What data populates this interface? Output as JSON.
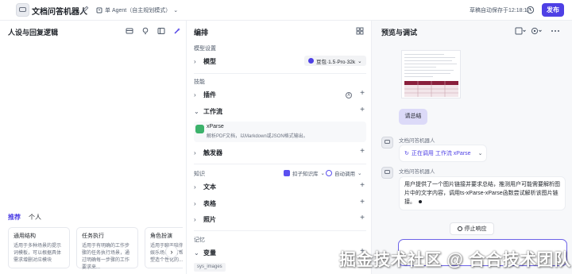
{
  "header": {
    "title": "文档问答机器人",
    "mode_label": "单 Agent（自主规划模式）",
    "autosave": "草稿自动保存于12:18:17",
    "publish_label": "发布"
  },
  "left_panel": {
    "title": "人设与回复逻辑",
    "tabs": [
      {
        "label": "推荐",
        "active": true
      },
      {
        "label": "个人",
        "active": false
      }
    ],
    "cards": [
      {
        "title": "通用结构",
        "desc": "适用于多种场景的提示词模板，可以根据具体需求增删对应模块"
      },
      {
        "title": "任务执行",
        "desc": "适用于有明确的工作步骤的任务执行场景，通过明确每一步骤的工作要求来..."
      },
      {
        "title": "角色扮演",
        "desc": "适用于聊天陪伴、互动娱乐场景，可帮助模型塑造个性化的..."
      }
    ],
    "next_arrow": "›"
  },
  "middle_panel": {
    "title": "编排",
    "model_section": "模型设置",
    "model_row": "模型",
    "model_name": "豆包·1.5·Pro·32k",
    "skills_section": "技能",
    "plugin_row": "插件",
    "workflow_row": "工作流",
    "workflow_item": {
      "name": "xParse",
      "desc": "解析PDF文档，以Markdown或JSON格式输出。"
    },
    "trigger_row": "触发器",
    "knowledge_section": "知识",
    "kb_button": "扣子知识库",
    "auto_call": "自动调用",
    "text_row": "文本",
    "table_row": "表格",
    "photo_row": "照片",
    "memory_section": "记忆",
    "variable_row": "变量",
    "variable_tag": "sys_images"
  },
  "right_panel": {
    "title": "预览与调试",
    "user_message": "请总结",
    "bot_name_1": "文档问答机器人",
    "calling_text": "正在调用 工作流 xParse",
    "bot_name_2": "文档问答机器人",
    "answer": "用户提供了一个图片链接并要求总结，推测用户可能需要解析图片中的文字内容，调用ts-xParse-xParse函数尝试解析该图片链接。",
    "stop_label": "停止响应"
  },
  "watermark": "掘金技术社区 @ 合合技术团队",
  "colors": {
    "accent": "#4e40e5",
    "user_bubble": "#dcdaf8",
    "workflow_icon": "#3cb26b"
  }
}
